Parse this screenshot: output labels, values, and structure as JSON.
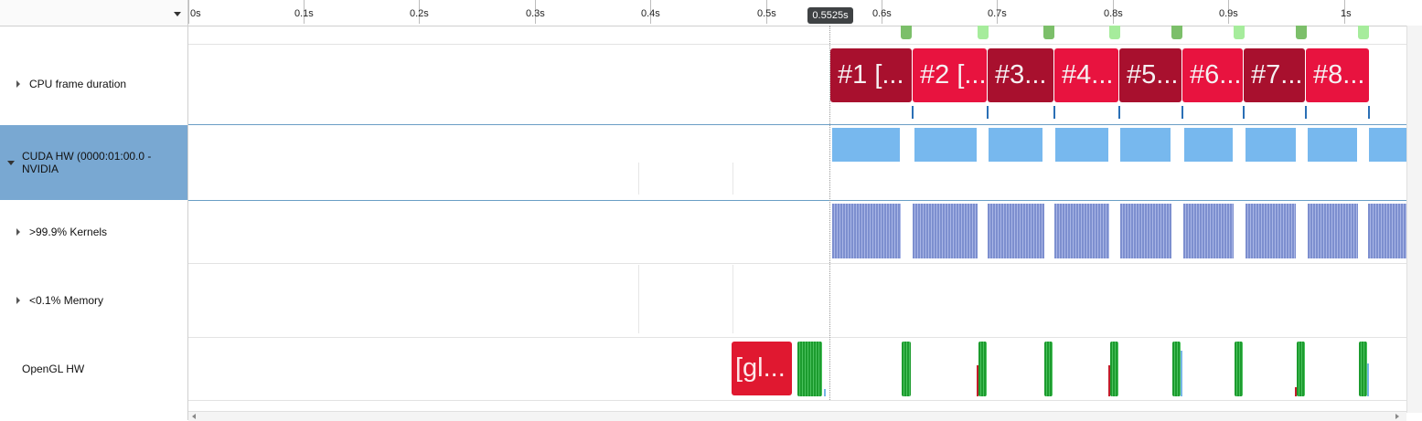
{
  "left_panel": {
    "rows": [
      {
        "label": "CPU frame duration",
        "expander": "collapsed"
      },
      {
        "label": "CUDA HW (0000:01:00.0 - NVIDIA",
        "expander": "expanded",
        "selected": true
      },
      {
        "label": ">99.9% Kernels",
        "expander": "collapsed"
      },
      {
        "label": "<0.1% Memory",
        "expander": "collapsed"
      },
      {
        "label": "OpenGL HW",
        "expander": "none"
      }
    ]
  },
  "ruler": {
    "ticks": [
      "0s",
      "0.1s",
      "0.2s",
      "0.3s",
      "0.4s",
      "0.5s",
      "0.6s",
      "0.7s",
      "0.8s",
      "0.9s",
      "1s"
    ],
    "cursor_label": "0.5525s"
  },
  "frames": [
    "#1 [...",
    "#2 [...",
    "#3...",
    "#4...",
    "#5...",
    "#6...",
    "#7...",
    "#8..."
  ],
  "opengl_block_label": "[gl...",
  "colors": {
    "frame_dark": "#a8102e",
    "frame_bright": "#e8133f",
    "cuda_blue": "#77b8ee",
    "kernel_blue": "#7d8fcf",
    "gl_green": "#1c9b2e",
    "selection": "#79a8d2"
  }
}
